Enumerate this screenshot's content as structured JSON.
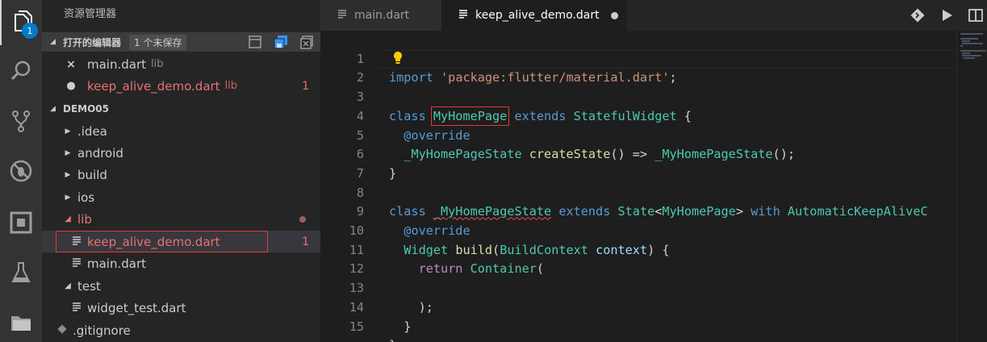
{
  "activity_bar": {
    "items": [
      {
        "icon": "files-icon",
        "badge": "1"
      },
      {
        "icon": "search-icon"
      },
      {
        "icon": "source-control-icon"
      },
      {
        "icon": "debug-icon"
      },
      {
        "icon": "extensions-icon"
      },
      {
        "icon": "test-flask-icon"
      },
      {
        "icon": "folder-icon"
      }
    ]
  },
  "sidebar": {
    "title": "资源管理器",
    "open_editors": {
      "label": "打开的编辑器",
      "unsaved": "1 个未保存",
      "items": [
        {
          "lead": "×",
          "name": "main.dart",
          "desc": "lib",
          "count": ""
        },
        {
          "lead": "●",
          "name": "keep_alive_demo.dart",
          "desc": "lib",
          "count": "1"
        }
      ]
    },
    "folder": {
      "label": "DEMO05",
      "tree": [
        {
          "name": ".idea",
          "kind": "folder",
          "expanded": false
        },
        {
          "name": "android",
          "kind": "folder",
          "expanded": false
        },
        {
          "name": "build",
          "kind": "folder",
          "expanded": false
        },
        {
          "name": "ios",
          "kind": "folder",
          "expanded": false
        },
        {
          "name": "lib",
          "kind": "folder",
          "expanded": true
        },
        {
          "name": "keep_alive_demo.dart",
          "kind": "file",
          "count": "1"
        },
        {
          "name": "main.dart",
          "kind": "file"
        },
        {
          "name": "test",
          "kind": "folder",
          "expanded": true
        },
        {
          "name": "widget_test.dart",
          "kind": "file"
        },
        {
          "name": ".gitignore",
          "kind": "file"
        }
      ]
    }
  },
  "tabs": [
    {
      "label": "main.dart",
      "active": false
    },
    {
      "label": "keep_alive_demo.dart",
      "active": true,
      "dirty": true
    }
  ],
  "tab_actions": [
    "git-compare-icon",
    "run-icon",
    "split-editor-icon"
  ],
  "editor": {
    "line_numbers": [
      "1",
      "2",
      "3",
      "4",
      "5",
      "6",
      "7",
      "8",
      "9",
      "10",
      "11",
      "12",
      "13",
      "14",
      "15"
    ],
    "lines": {
      "l1_import": "import",
      "l1_str": "'package:flutter/material.dart'",
      "l1_end": ";",
      "l3_class": "class",
      "l3_name": "MyHomePage",
      "l3_extends": "extends",
      "l3_super": "StatefulWidget",
      "l3_brace": " {",
      "l4_anno": "@override",
      "l5_type": "_MyHomePageState",
      "l5_fn": "createState",
      "l5_mid": "() => ",
      "l5_ctor": "_MyHomePageState",
      "l5_end": "();",
      "l6": "}",
      "l8_class": "class",
      "l8_name": "_MyHomePageState",
      "l8_extends": "extends",
      "l8_super": "State",
      "l8_lt": "<",
      "l8_arg": "MyHomePage",
      "l8_gt": ">",
      "l8_with": "with",
      "l8_mixin": "AutomaticKeepAliveC",
      "l9_anno": "@override",
      "l10_type": "Widget",
      "l10_fn": "build",
      "l10_paren": "(",
      "l10_ptype": "BuildContext",
      "l10_pname": "context",
      "l10_end": ") {",
      "l11_return": "return",
      "l11_ctor": "Container",
      "l11_paren": "(",
      "l13": ");",
      "l14": "}",
      "l15": "}"
    }
  },
  "colors": {
    "accent": "#007acc",
    "error": "#e57373",
    "highlight_box": "#e53935"
  }
}
